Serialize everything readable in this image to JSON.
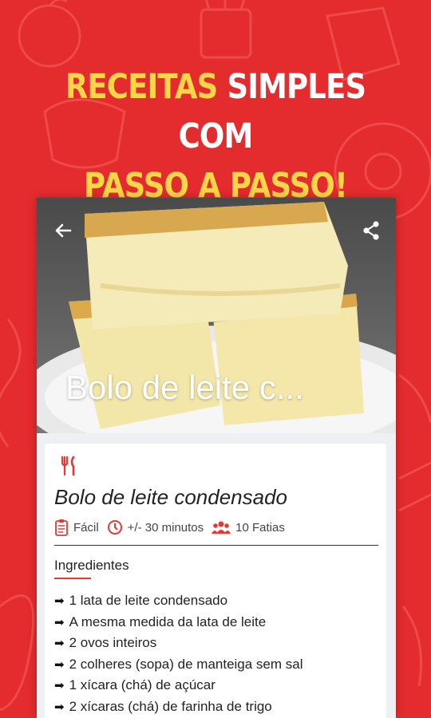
{
  "headline": {
    "line1_part1": "RECEITAS",
    "line1_part2": "SIMPLES COM",
    "line2": "PASSO A PASSO!"
  },
  "colors": {
    "background": "#e42b2d",
    "headline_yellow": "#f9d648",
    "headline_white": "#ffffff",
    "accent": "#e53935"
  },
  "app": {
    "hero_title": "Bolo de leite c...",
    "toolbar_icons": [
      "arrow-back-icon",
      "share-icon"
    ]
  },
  "recipe": {
    "title": "Bolo de leite condensado",
    "difficulty": "Fácil",
    "time": "+/- 30 minutos",
    "servings": "10 Fatias",
    "ingredients_heading": "Ingredientes",
    "ingredients": [
      "1 lata de leite condensado",
      "A mesma medida da lata de leite",
      "2 ovos inteiros",
      "2 colheres (sopa) de manteiga sem sal",
      "1 xícara (chá) de açúcar",
      "2 xícaras (chá) de farinha de trigo"
    ]
  }
}
